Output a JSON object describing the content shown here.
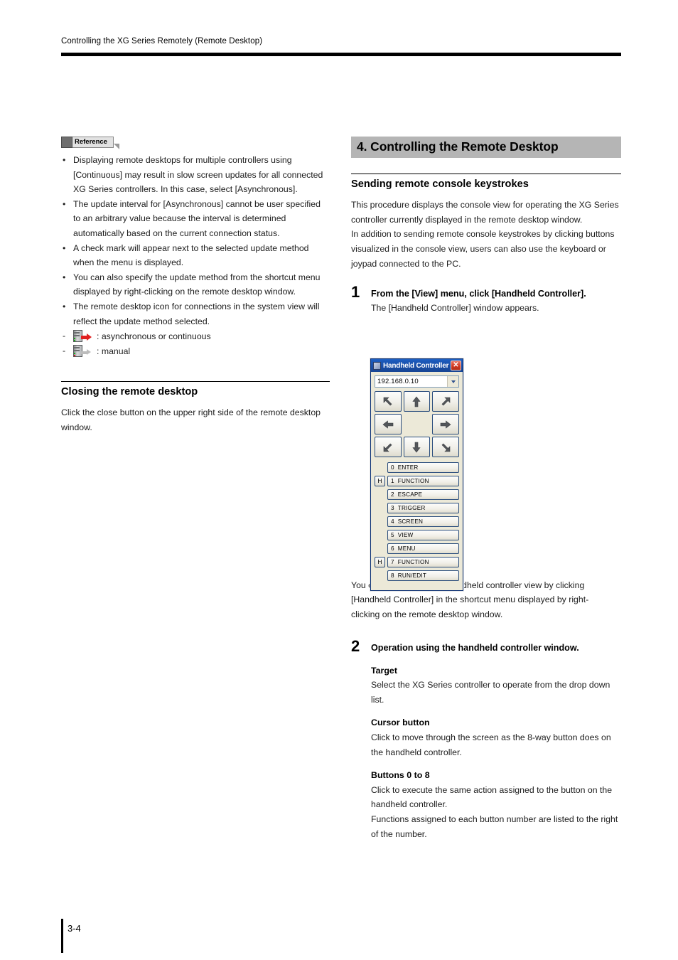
{
  "header": {
    "running_title": "Controlling the XG Series Remotely (Remote Desktop)"
  },
  "footer": {
    "page_number": "3-4"
  },
  "left_column": {
    "reference_badge_label": "Reference",
    "reference_bullets": [
      "Displaying remote desktops for multiple controllers using [Continuous] may result in slow screen updates for all connected XG Series controllers. In this case, select [Asynchronous].",
      "The update interval for [Asynchronous] cannot be user specified to an arbitrary value because the interval is determined automatically based on the current connection status.",
      "A check mark will appear next to the selected update method when the menu is displayed.",
      "You can also specify the update method from the shortcut menu displayed by right-clicking on the remote desktop window.",
      "The remote desktop icon for connections in the system view will reflect the update method selected."
    ],
    "icon_legend": [
      {
        "dash": "-",
        "icon": "server-rack-red-arrow-icon",
        "arrow_color": "#e02020",
        "label": ": asynchronous or continuous"
      },
      {
        "dash": "-",
        "icon": "server-rack-gray-arrow-icon",
        "arrow_color": "#b9b9b9",
        "label": ": manual"
      }
    ],
    "closing_section": {
      "heading": "Closing the remote desktop",
      "body": "Click the close button on the upper right side of the remote desktop window."
    }
  },
  "right_column": {
    "chapter_heading": "4. Controlling the Remote Desktop",
    "section_heading": "Sending remote console keystrokes",
    "intro_paragraph_1": "This procedure displays the console view for operating the XG Series controller currently displayed in the remote desktop window.",
    "intro_paragraph_2": "In addition to sending remote console keystrokes by clicking buttons visualized in the console view, users can also use the keyboard or joypad connected to the PC.",
    "step1": {
      "number": "1",
      "title": "From the [View] menu, click [Handheld Controller].",
      "body": "The [Handheld Controller] window appears."
    },
    "reference_badge_label": "Reference",
    "reference_note": "You can also display the handheld controller view by clicking [Handheld Controller] in the shortcut menu displayed by right-clicking on the remote desktop window.",
    "step2": {
      "number": "2",
      "title": "Operation using the handheld controller window.",
      "blocks": [
        {
          "heading": "Target",
          "lines": [
            "Select the XG Series controller to operate from the drop down list."
          ]
        },
        {
          "heading": "Cursor button",
          "lines": [
            "Click to move through the screen as the 8-way button does on the handheld controller."
          ]
        },
        {
          "heading": "Buttons 0 to 8",
          "lines": [
            "Click to execute the same action assigned to the button on the handheld controller.",
            "Functions assigned to each button number are listed to the right of the number."
          ]
        }
      ]
    }
  },
  "handheld_controller_dialog": {
    "title": "Handheld Controller",
    "title_icon": "app-icon",
    "close_label": "✕",
    "target_combo": {
      "value": "192.168.0.10",
      "arrow_icon": "chevron-down-icon"
    },
    "dpad_buttons": [
      {
        "name": "arrow-up-left-icon",
        "dir": "up-left"
      },
      {
        "name": "arrow-up-icon",
        "dir": "up"
      },
      {
        "name": "arrow-up-right-icon",
        "dir": "up-right"
      },
      {
        "name": "arrow-left-icon",
        "dir": "left"
      },
      {
        "name": "dpad-center-empty",
        "dir": "none"
      },
      {
        "name": "arrow-right-icon",
        "dir": "right"
      },
      {
        "name": "arrow-down-left-icon",
        "dir": "down-left"
      },
      {
        "name": "arrow-down-icon",
        "dir": "down"
      },
      {
        "name": "arrow-down-right-icon",
        "dir": "down-right"
      }
    ],
    "hotkey_label": "H",
    "numbered_buttons": [
      {
        "hotkey": "",
        "number": "0",
        "label": "ENTER"
      },
      {
        "hotkey": "H",
        "number": "1",
        "label": "FUNCTION"
      },
      {
        "hotkey": "",
        "number": "2",
        "label": "ESCAPE"
      },
      {
        "hotkey": "",
        "number": "3",
        "label": "TRIGGER"
      },
      {
        "hotkey": "",
        "number": "4",
        "label": "SCREEN"
      },
      {
        "hotkey": "",
        "number": "5",
        "label": "VIEW"
      },
      {
        "hotkey": "",
        "number": "6",
        "label": "MENU"
      },
      {
        "hotkey": "H",
        "number": "7",
        "label": "FUNCTION"
      },
      {
        "hotkey": "",
        "number": "8",
        "label": "RUN/EDIT"
      }
    ]
  },
  "colors": {
    "chapter_heading_bg": "#b5b5b5",
    "titlebar_blue": "#1a50ab",
    "close_red": "#d33a22",
    "dialog_face": "#ece9d8",
    "async_arrow": "#e02020",
    "manual_arrow": "#b9b9b9"
  }
}
